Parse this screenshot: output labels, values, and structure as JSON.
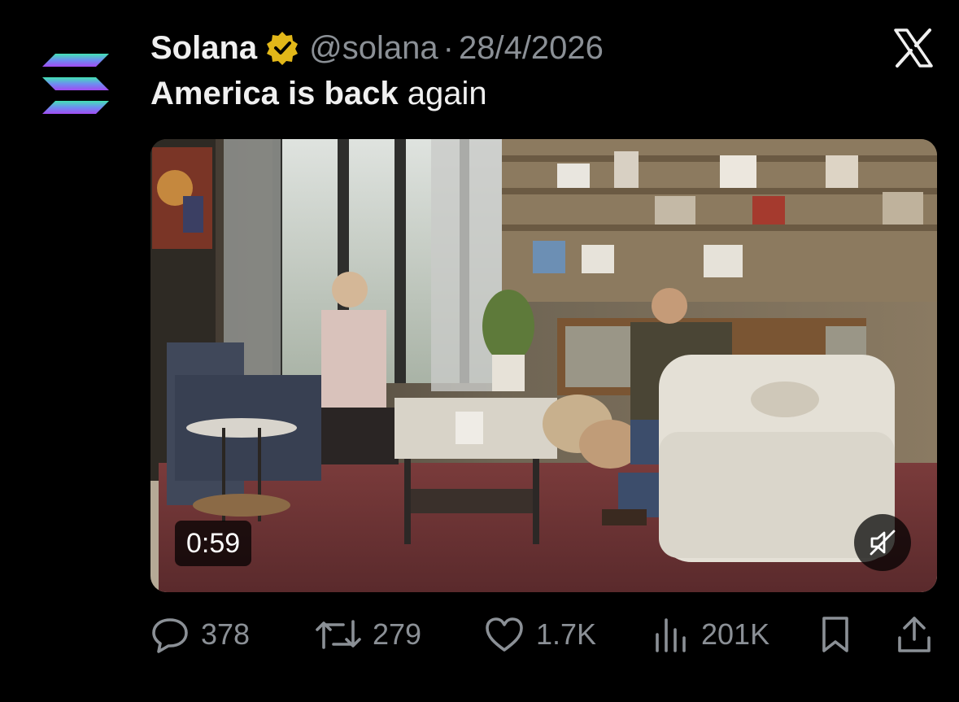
{
  "tweet": {
    "display_name": "Solana",
    "handle": "@solana",
    "separator": "·",
    "date": "28/4/2026",
    "text_bold": "America is back",
    "text_rest": " again",
    "avatar_icon": "solana-logo-icon",
    "verified_icon": "gold-verified-badge-icon",
    "platform_icon": "x-logo-icon"
  },
  "media": {
    "duration": "0:59",
    "mute_icon": "speaker-muted-icon"
  },
  "actions": {
    "replies": "378",
    "reposts": "279",
    "likes": "1.7K",
    "views": "201K",
    "reply_icon": "reply-bubble-icon",
    "repost_icon": "repost-icon",
    "like_icon": "heart-icon",
    "views_icon": "views-bar-chart-icon",
    "bookmark_icon": "bookmark-icon",
    "share_icon": "share-icon"
  },
  "colors": {
    "background": "#000000",
    "text_primary": "#f0f0f0",
    "text_secondary": "#8b9096",
    "verified_gold": "#e2b719"
  }
}
